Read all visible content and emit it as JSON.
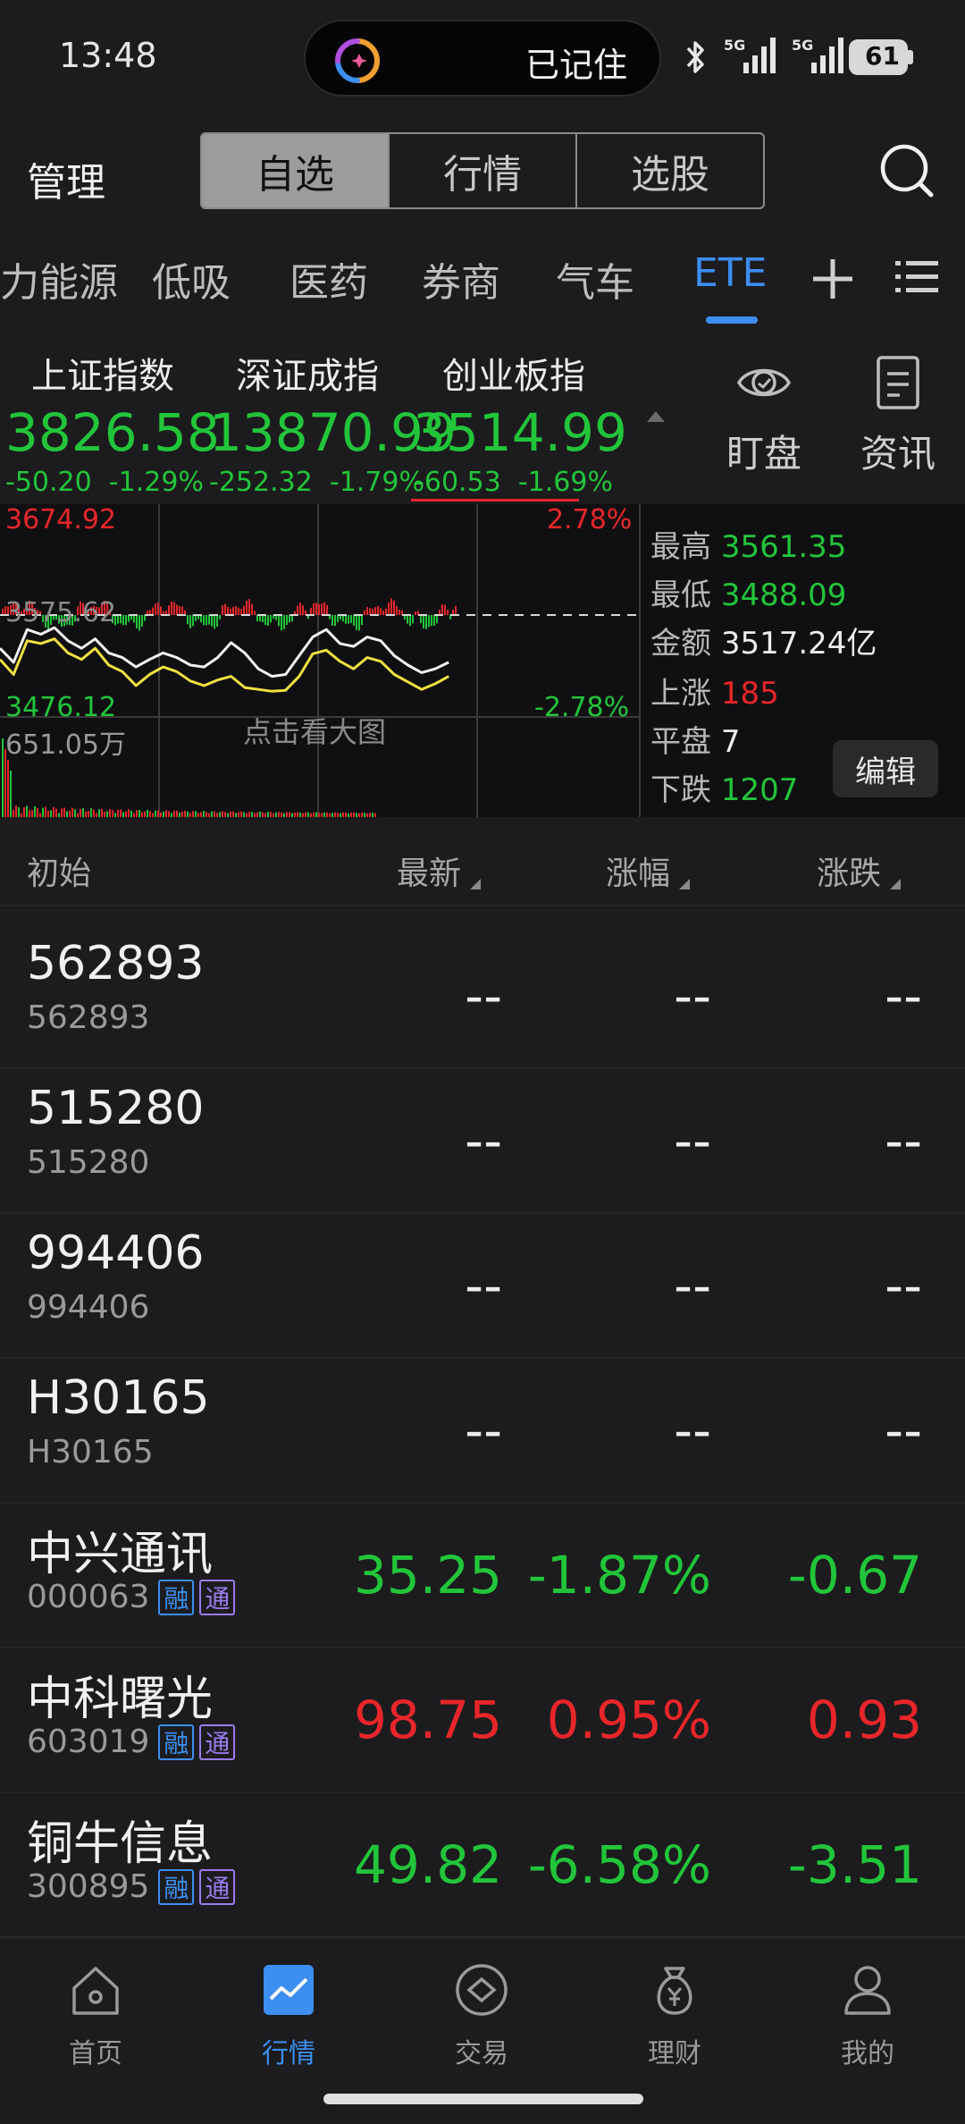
{
  "status_bar": {
    "time": "13:48",
    "island_text": "已记住",
    "signal_1": "5G",
    "signal_2": "5G",
    "battery": "61"
  },
  "header": {
    "manage": "管理",
    "segments": [
      "自选",
      "行情",
      "选股"
    ],
    "active_segment": 0
  },
  "categories": {
    "items": [
      "力能源",
      "低吸",
      "医药",
      "券商",
      "气车",
      "ETE"
    ],
    "active": "ETE"
  },
  "indices": [
    {
      "name": "上证指数",
      "value": "3826.58",
      "change": "-50.20",
      "pct": "-1.29%"
    },
    {
      "name": "深证成指",
      "value": "13870.99",
      "change": "-252.32",
      "pct": "-1.79%"
    },
    {
      "name": "创业板指",
      "value": "3514.99",
      "change": "-60.53",
      "pct": "-1.69%"
    }
  ],
  "side_buttons": {
    "watch": "盯盘",
    "news": "资讯"
  },
  "chart": {
    "high_label": "3674.92",
    "high_pct": "2.78%",
    "mid_label": "3575.62",
    "low_label": "3476.12",
    "low_pct": "-2.78%",
    "volume_label": "651.05万",
    "enlarge_hint": "点击看大图"
  },
  "chart_data": {
    "type": "line",
    "title": "",
    "ylim": [
      3476.12,
      3674.92
    ],
    "prev_close": 3575.62,
    "series": [
      {
        "values": [
          3540,
          3525,
          3560,
          3555,
          3562,
          3548,
          3540,
          3550,
          3535,
          3530,
          3520,
          3528,
          3535,
          3530,
          3522,
          3520,
          3530,
          3546,
          3535,
          3518,
          3510,
          3512,
          3532,
          3552,
          3560,
          3545,
          3542,
          3552,
          3548,
          3532,
          3522,
          3514,
          3518,
          3525
        ]
      },
      {
        "values": [
          3528,
          3512,
          3548,
          3545,
          3550,
          3535,
          3528,
          3540,
          3522,
          3515,
          3500,
          3512,
          3520,
          3515,
          3505,
          3500,
          3506,
          3510,
          3498,
          3496,
          3494,
          3495,
          3510,
          3534,
          3538,
          3526,
          3518,
          3530,
          3526,
          3512,
          3504,
          3496,
          3502,
          3510
        ]
      }
    ]
  },
  "stats": {
    "high": {
      "label": "最高",
      "value": "3561.35"
    },
    "low": {
      "label": "最低",
      "value": "3488.09"
    },
    "amount": {
      "label": "金额",
      "value": "3517.24亿"
    },
    "up": {
      "label": "上涨",
      "value": "185"
    },
    "flat": {
      "label": "平盘",
      "value": "7"
    },
    "down": {
      "label": "下跌",
      "value": "1207"
    },
    "edit": "编辑"
  },
  "table": {
    "headers": {
      "name": "初始",
      "latest": "最新",
      "pct": "涨幅",
      "chg": "涨跌"
    },
    "rows": [
      {
        "name": "562893",
        "code": "562893",
        "latest": "--",
        "pct": "--",
        "chg": "--",
        "color": "white",
        "tags": []
      },
      {
        "name": "515280",
        "code": "515280",
        "latest": "--",
        "pct": "--",
        "chg": "--",
        "color": "white",
        "tags": []
      },
      {
        "name": "994406",
        "code": "994406",
        "latest": "--",
        "pct": "--",
        "chg": "--",
        "color": "white",
        "tags": []
      },
      {
        "name": "H30165",
        "code": "H30165",
        "latest": "--",
        "pct": "--",
        "chg": "--",
        "color": "white",
        "tags": []
      },
      {
        "name": "中兴通讯",
        "code": "000063",
        "latest": "35.25",
        "pct": "-1.87%",
        "chg": "-0.67",
        "color": "green",
        "tags": [
          "融",
          "通"
        ]
      },
      {
        "name": "中科曙光",
        "code": "603019",
        "latest": "98.75",
        "pct": "0.95%",
        "chg": "0.93",
        "color": "red",
        "tags": [
          "融",
          "通"
        ]
      },
      {
        "name": "铜牛信息",
        "code": "300895",
        "latest": "49.82",
        "pct": "-6.58%",
        "chg": "-3.51",
        "color": "green",
        "tags": [
          "融",
          "通"
        ]
      }
    ]
  },
  "bottom_nav": {
    "items": [
      {
        "label": "首页",
        "icon": "home-icon"
      },
      {
        "label": "行情",
        "icon": "market-chart-icon"
      },
      {
        "label": "交易",
        "icon": "trade-icon"
      },
      {
        "label": "理财",
        "icon": "wealth-bag-icon"
      },
      {
        "label": "我的",
        "icon": "profile-icon"
      }
    ],
    "active": 1
  },
  "colors": {
    "up": "#e8262a",
    "down": "#22c53a",
    "accent": "#3c8ef0"
  }
}
